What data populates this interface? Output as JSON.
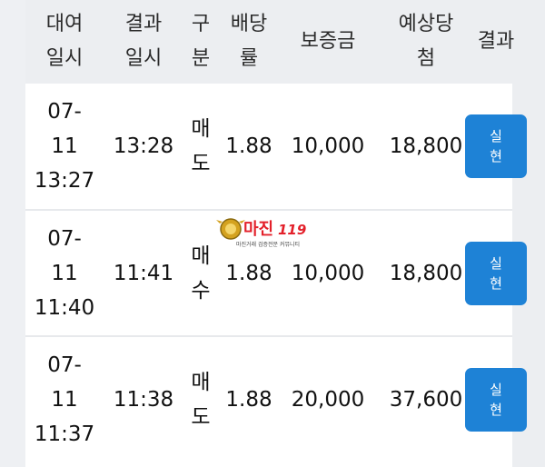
{
  "headers": {
    "order_time": [
      "대여",
      "일시"
    ],
    "result_time": [
      "결과",
      "일시"
    ],
    "type": [
      "구",
      "분"
    ],
    "odds": [
      "배당",
      "률"
    ],
    "stake": [
      "보증금"
    ],
    "payout": [
      "예상당",
      "첨"
    ],
    "result": [
      "결과"
    ]
  },
  "rows": [
    {
      "order_time": [
        "07-",
        "11",
        "13:27"
      ],
      "result_time": "13:28",
      "type": [
        "매",
        "도"
      ],
      "type_kind": "sell",
      "odds": "1.88",
      "stake": "10,000",
      "payout": "18,800",
      "result": [
        "실",
        "현"
      ]
    },
    {
      "order_time": [
        "07-",
        "11",
        "11:40"
      ],
      "result_time": "11:41",
      "type": [
        "매",
        "수"
      ],
      "type_kind": "buy",
      "odds": "1.88",
      "stake": "10,000",
      "payout": "18,800",
      "result": [
        "실",
        "현"
      ]
    },
    {
      "order_time": [
        "07-",
        "11",
        "11:37"
      ],
      "result_time": "11:38",
      "type": [
        "매",
        "도"
      ],
      "type_kind": "sell",
      "odds": "1.88",
      "stake": "20,000",
      "payout": "37,600",
      "result": [
        "실",
        "현"
      ]
    }
  ],
  "watermark": {
    "title": "마진",
    "number": "119",
    "tagline": "마진거래 검증전문 커뮤니티"
  },
  "colors": {
    "sell": "#1a1fd6",
    "buy": "#e0261a",
    "result_button": "#1e82d6"
  }
}
